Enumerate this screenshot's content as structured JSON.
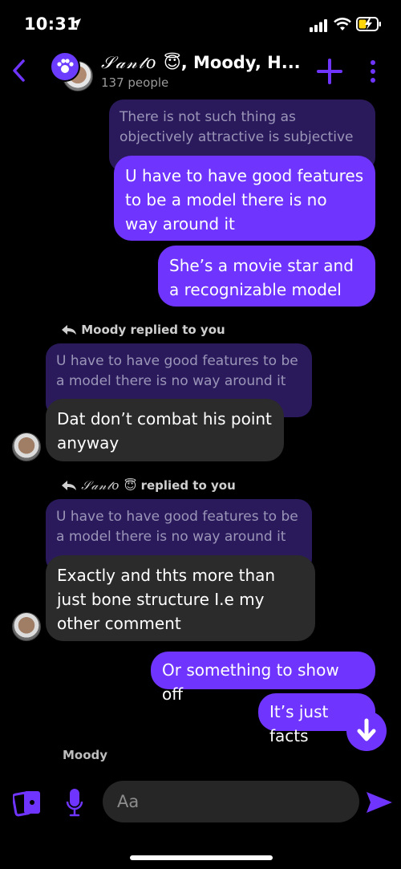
{
  "status": {
    "time": "10:31"
  },
  "header": {
    "title_script": "𝒮𝒶𝓃𝓉𝑜",
    "title_emoji": "😇",
    "title_rest": ", Moody, H...",
    "subtitle": "137 people"
  },
  "messages": {
    "quote1": "There is not such thing as objectively attractive is subjective",
    "m1": "U have to have good features to be a model there is no way around it",
    "m2": "She’s a movie star and a recognizable model",
    "reply_label_1": "Moody replied to you",
    "quote2": "U have to have good features to be a model there is no way around it",
    "m3": "Dat don’t combat his point anyway",
    "reply_label_2_name": "𝒮𝒶𝓃𝓉𝑜",
    "reply_label_2_emoji": "😇",
    "reply_label_2_text": "replied to you",
    "quote3": "U have to have good features to be a model there is no way around it",
    "m4": "Exactly and thts more than just bone structure I.e my other comment",
    "m5": "Or something to show off",
    "m6": "It’s just facts",
    "sender": "Moody"
  },
  "composer": {
    "placeholder": "Aa"
  },
  "colors": {
    "accent": "#6f35ff",
    "incoming": "#2b2b2b",
    "quote": "#2a1a5c"
  }
}
